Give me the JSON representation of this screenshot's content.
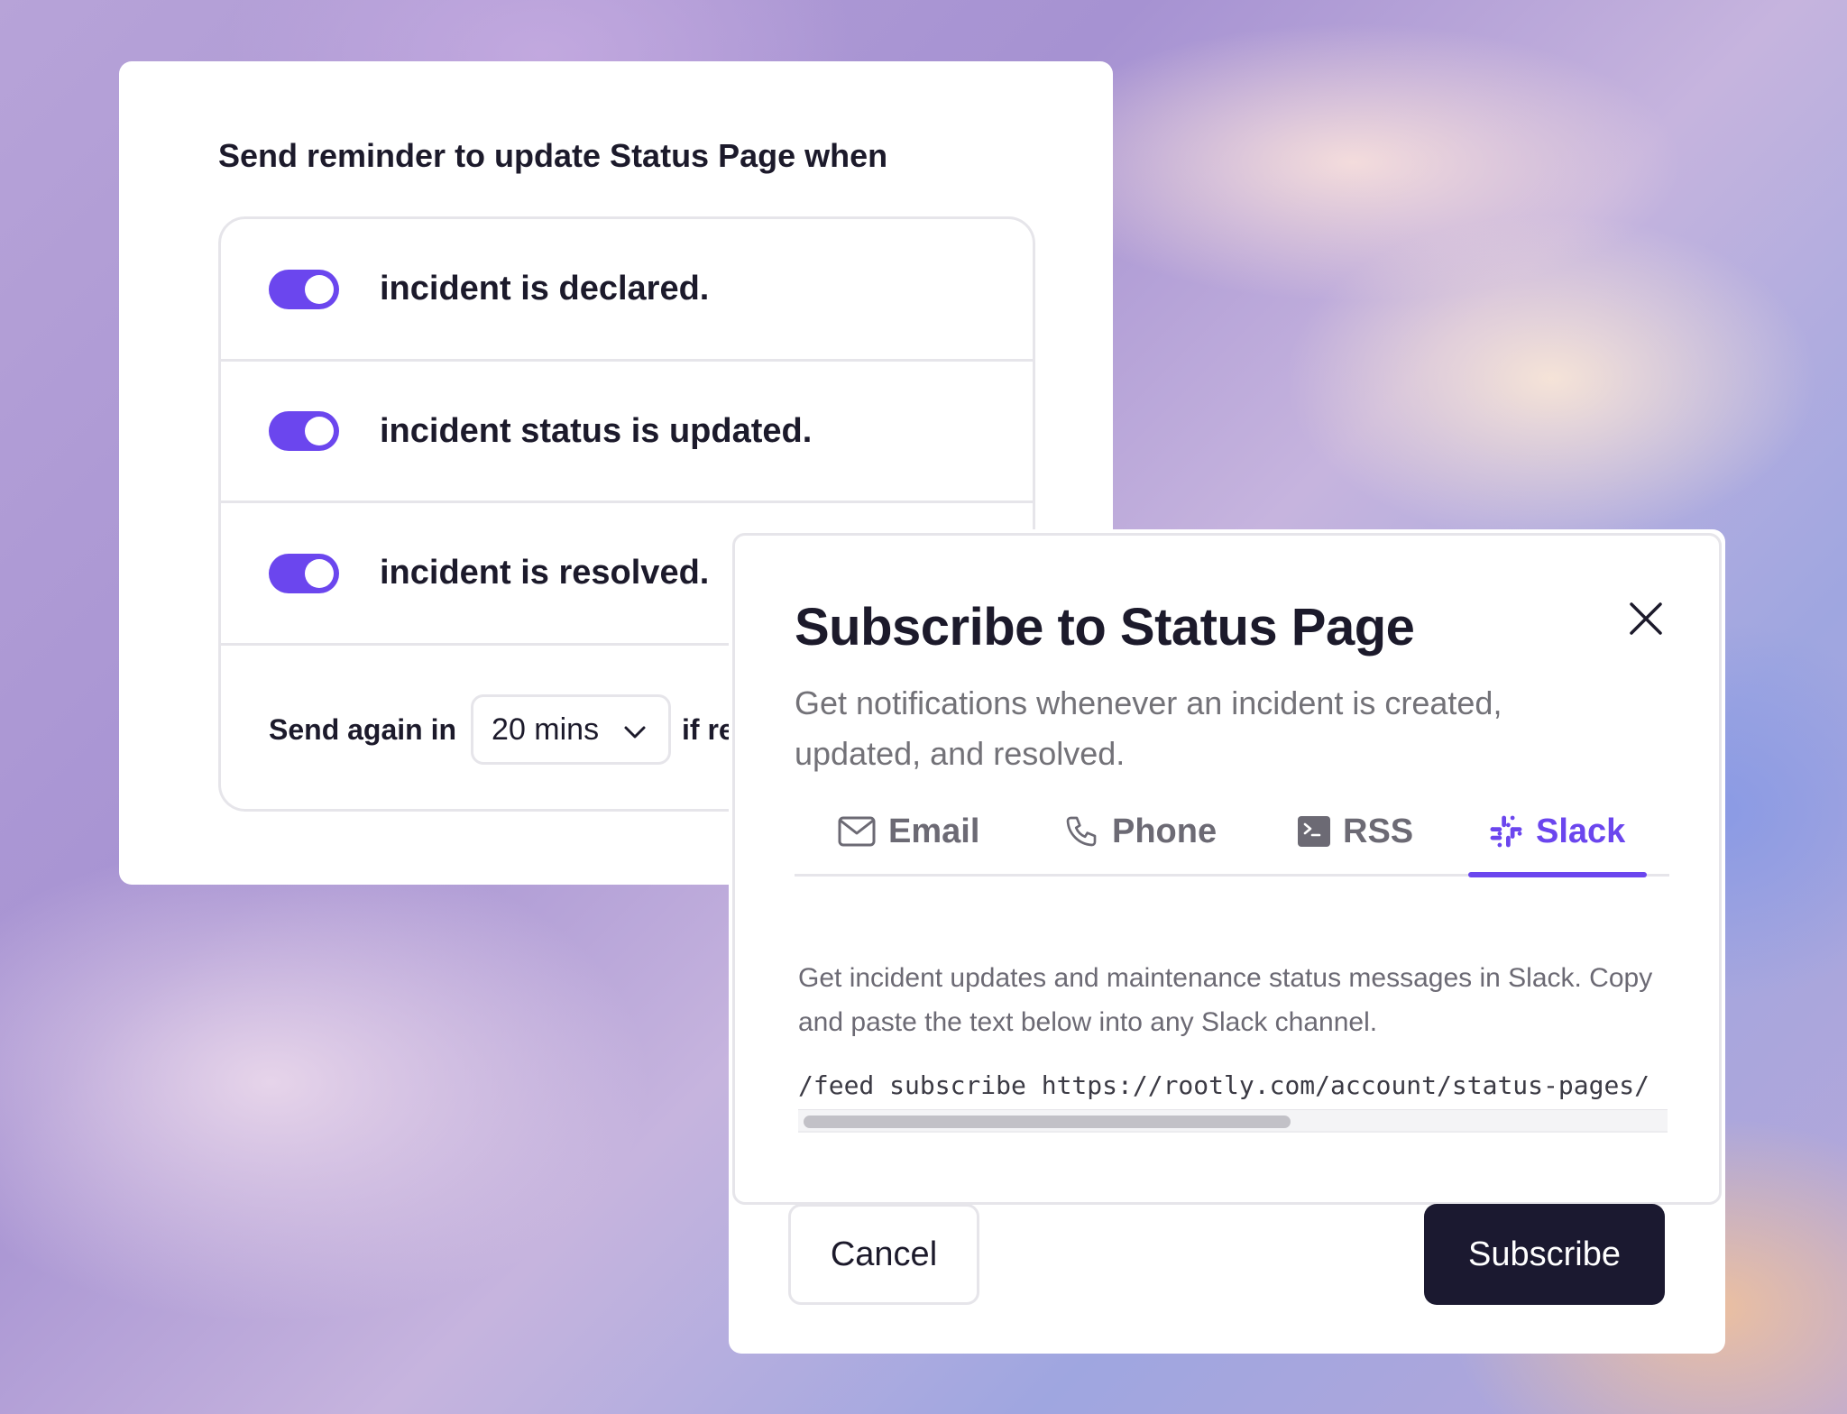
{
  "reminder": {
    "title": "Send reminder to update Status Page when",
    "rules": [
      {
        "label": "incident is declared.",
        "enabled": true
      },
      {
        "label": "incident status is updated.",
        "enabled": true
      },
      {
        "label": "incident is resolved.",
        "enabled": true
      }
    ],
    "resend": {
      "prefix": "Send again in",
      "interval": "20 mins",
      "suffix": "if re"
    }
  },
  "modal": {
    "title": "Subscribe to Status Page",
    "description": "Get notifications whenever an incident is created, updated, and resolved.",
    "tabs": [
      {
        "label": "Email",
        "icon": "envelope-icon"
      },
      {
        "label": "Phone",
        "icon": "phone-icon"
      },
      {
        "label": "RSS",
        "icon": "terminal-icon"
      },
      {
        "label": "Slack",
        "icon": "slack-icon"
      }
    ],
    "active_tab": "Slack",
    "slack_description": "Get incident updates and maintenance status messages in Slack. Copy and paste the text below into any Slack channel.",
    "slack_command": "/feed subscribe https://rootly.com/account/status-pages/",
    "cancel_label": "Cancel",
    "subscribe_label": "Subscribe"
  },
  "colors": {
    "accent": "#6b46ee",
    "dark_button": "#1b1930",
    "text": "#1c1a2b",
    "muted_text": "#737278"
  }
}
